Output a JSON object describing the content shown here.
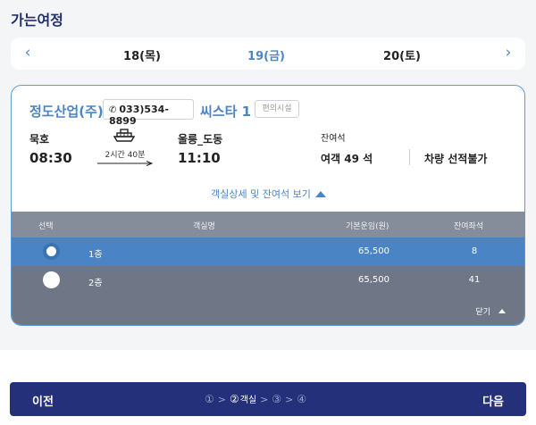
{
  "section_title": "가는여정",
  "date_bar": {
    "prev_icon": "chevron-left-icon",
    "next_icon": "chevron-right-icon",
    "dates": [
      "18(목)",
      "19(금)",
      "20(토)"
    ],
    "selected_index": 1
  },
  "voyage": {
    "company": "정도산업(주)",
    "phone": "033)534-8899",
    "ship": "씨스타 1",
    "facility_label": "편의시설",
    "departure": {
      "port": "묵호",
      "time": "08:30"
    },
    "duration": "2시간 40분",
    "arrival": {
      "port": "울릉_도동",
      "time": "11:10"
    },
    "remain_label": "잔여석",
    "passenger_seats": "여객 49 석",
    "car_status": "차량 선적불가",
    "toggle_label": "객실상세 및 잔여석 보기"
  },
  "cabin_table": {
    "headers": {
      "select": "선택",
      "name": "객실명",
      "fare": "기본운임(원)",
      "remain": "잔여좌석"
    },
    "rows": [
      {
        "name": "1층",
        "fare": "65,500",
        "remain": "8",
        "selected": true
      },
      {
        "name": "2층",
        "fare": "65,500",
        "remain": "41",
        "selected": false
      }
    ],
    "close_label": "닫기"
  },
  "nav": {
    "prev_label": "이전",
    "next_label": "다음",
    "steps": [
      "①",
      "②",
      "③",
      "④"
    ],
    "active_step_label": "객실",
    "step_separator": ">"
  },
  "colors": {
    "accent_blue": "#4a86c5",
    "navy": "#24307a",
    "selected_row": "#4a84c4",
    "row_gray": "#6f7786"
  }
}
